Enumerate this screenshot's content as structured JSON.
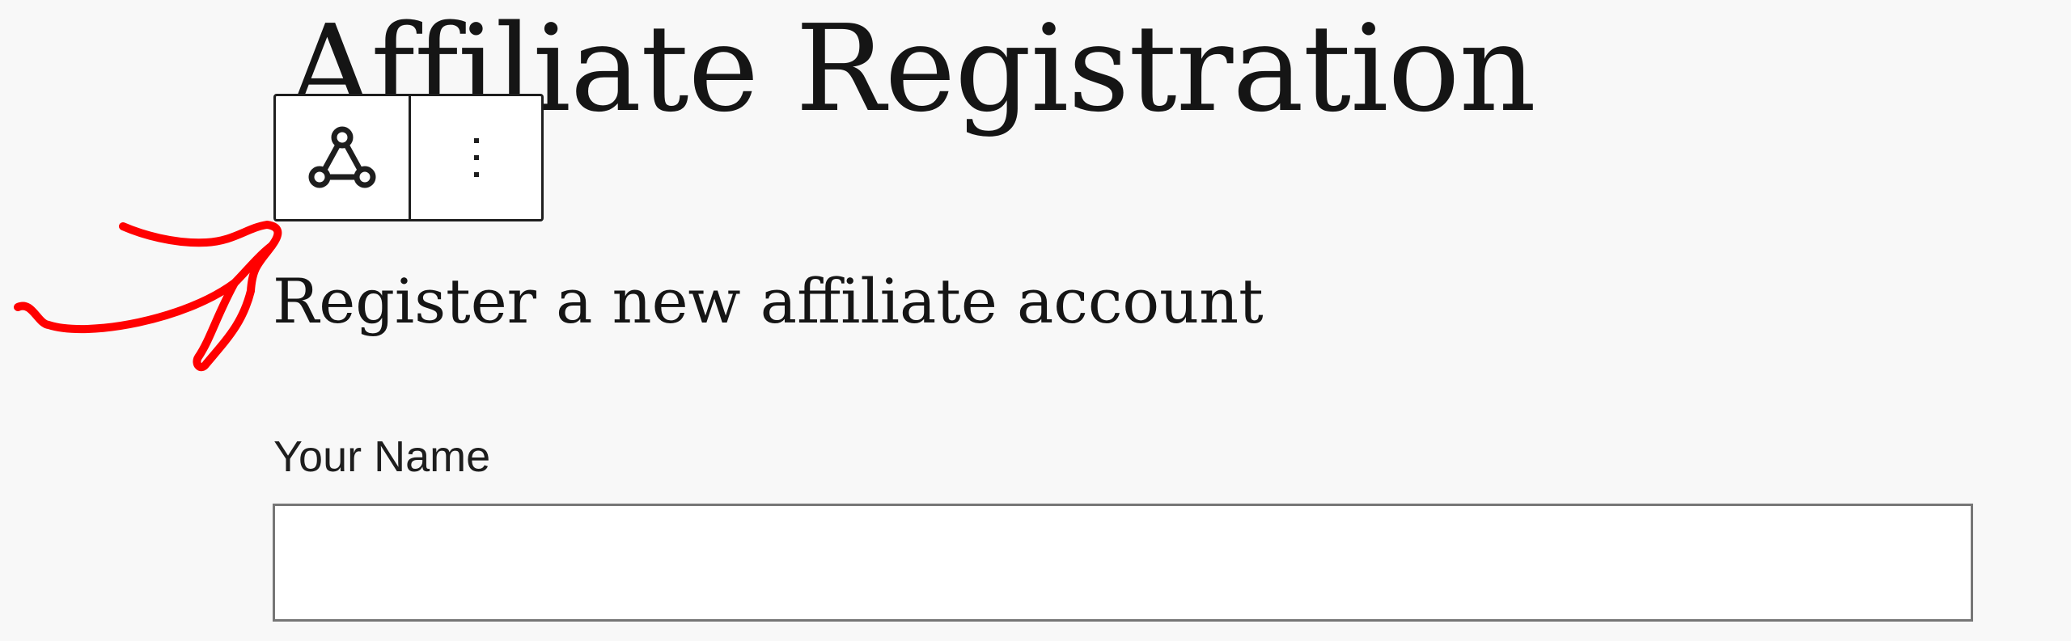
{
  "page": {
    "title": "Affiliate Registration",
    "subtitle": "Register a new affiliate account"
  },
  "toolbar": {
    "parent_block_icon": "parent-block-icon",
    "options_icon": "vertical-ellipsis-icon"
  },
  "form": {
    "name_label": "Your Name",
    "name_value": "",
    "name_placeholder": ""
  },
  "annotation": {
    "arrow_icon": "hand-drawn-arrow-icon",
    "arrow_color": "#ff0000"
  }
}
